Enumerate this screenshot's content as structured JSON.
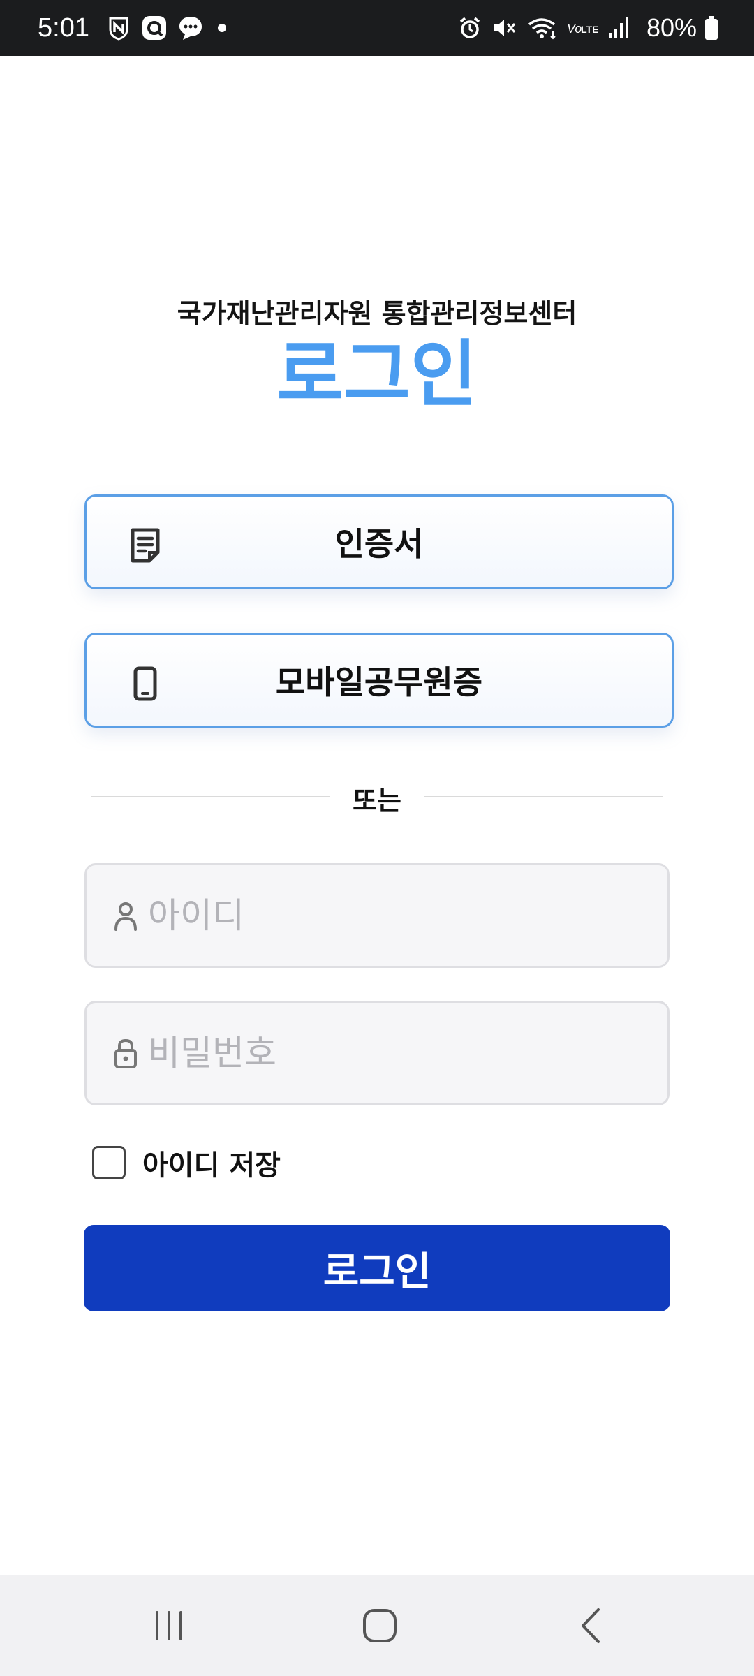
{
  "status_bar": {
    "time": "5:01",
    "battery": "80%",
    "left_icons": [
      "n-shield-icon",
      "q-app-icon",
      "chat-bubble-icon",
      "dot-icon"
    ],
    "right_icons": [
      "alarm-icon",
      "mute-icon",
      "wifi-icon",
      "volte-icon",
      "signal-icon",
      "battery-icon"
    ]
  },
  "header": {
    "subtitle": "국가재난관리자원 통합관리정보센터",
    "title": "로그인",
    "title_color": "#4a9cf0"
  },
  "auth_options": {
    "certificate_label": "인증서",
    "mobile_id_label": "모바일공무원증",
    "border_color": "#5b9fe6"
  },
  "divider": {
    "text": "또는"
  },
  "form": {
    "id_placeholder": "아이디",
    "id_value": "",
    "password_placeholder": "비밀번호",
    "password_value": "",
    "remember_label": "아이디 저장",
    "remember_checked": false,
    "submit_label": "로그인",
    "submit_color": "#103cbe"
  },
  "nav_bar": {
    "items": [
      "recents-icon",
      "home-icon",
      "back-icon"
    ]
  }
}
